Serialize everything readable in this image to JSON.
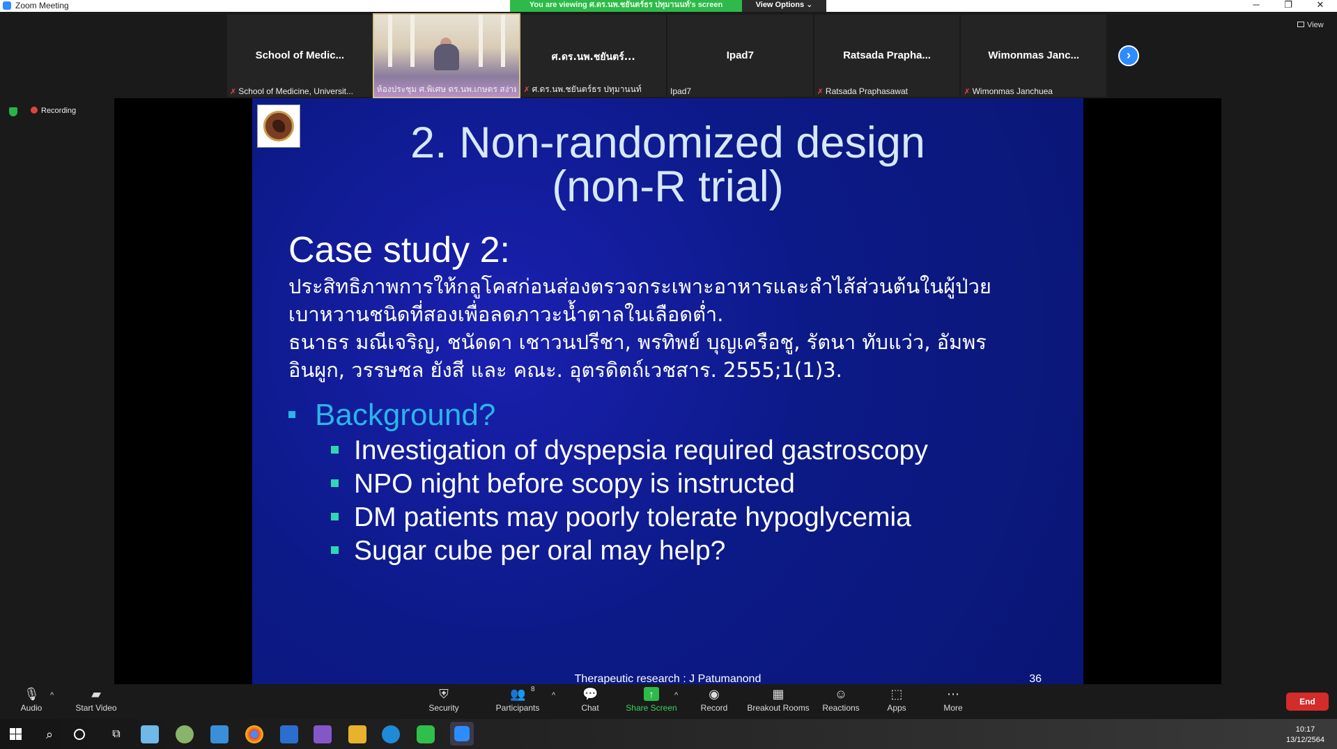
{
  "window": {
    "title": "Zoom Meeting",
    "banner": "You are viewing ศ.ดร.นพ.ชยันตร์ธร ปทุมานนท์'s screen",
    "view_options": "View Options ⌄",
    "view_label": "View"
  },
  "strip": {
    "tiles": [
      {
        "name": "School of Medic...",
        "label": "School of Medicine, Universit...",
        "muted": true
      },
      {
        "name": "",
        "label": "ห้องประชุม ศ.พิเศษ ดร.นพ.เกษตร สง่ามงคล...",
        "muted": false
      },
      {
        "name": "ศ.ดร.นพ.ชยันตร์...",
        "label": "ศ.ดร.นพ.ชยันตร์ธร ปทุมานนท์",
        "muted": true
      },
      {
        "name": "Ipad7",
        "label": "Ipad7",
        "muted": false
      },
      {
        "name": "Ratsada Prapha...",
        "label": "Ratsada Praphasawat",
        "muted": true
      },
      {
        "name": "Wimonmas Janc...",
        "label": "Wimonmas Janchuea",
        "muted": true
      }
    ]
  },
  "recording": "Recording",
  "slide": {
    "title_line1": "2. Non-randomized design",
    "title_line2": "(non-R trial)",
    "case_title": "Case study 2:",
    "thai_lines": [
      "ประสิทธิภาพการให้กลูโคสก่อนส่องตรวจกระเพาะอาหารและลำไส้ส่วนต้นในผู้ป่วย",
      "เบาหวานชนิดที่สองเพื่อลดภาวะน้ำตาลในเลือดต่ำ.",
      "ธนาธร มณีเจริญ, ชนัดดา เชาวนปรีชา, พรทิพย์ บุญเครือชู, รัตนา ทับแว่ว, อัมพร",
      "อินผูก, วรรษชล ยังสี และ คณะ. อุตรดิตถ์เวชสาร. 2555;1(1)3."
    ],
    "bullet": "Background?",
    "sub_bullets": [
      "Investigation of dyspepsia required gastroscopy",
      "NPO night before scopy is instructed",
      "DM patients may poorly tolerate hypoglycemia",
      "Sugar cube per oral may help?"
    ],
    "footer": "Therapeutic research : J Patumanond",
    "page_number": "36"
  },
  "toolbar": {
    "audio": "Audio",
    "start_video": "Start Video",
    "security": "Security",
    "participants": "Participants",
    "participants_count": "8",
    "chat": "Chat",
    "share_screen": "Share Screen",
    "record": "Record",
    "breakout_rooms": "Breakout Rooms",
    "reactions": "Reactions",
    "apps": "Apps",
    "more": "More",
    "end": "End"
  },
  "taskbar": {
    "time": "10:17",
    "date": "13/12/2564"
  },
  "colors": {
    "zoom_blue": "#2d8cff",
    "share_green": "#2dba4a",
    "end_red": "#d42b2b",
    "slide_bg": "#0c1a88",
    "title_color": "#d7e8fb",
    "bullet_blue": "#2bb5e8",
    "sub_bullet_teal": "#2fd7b0"
  }
}
